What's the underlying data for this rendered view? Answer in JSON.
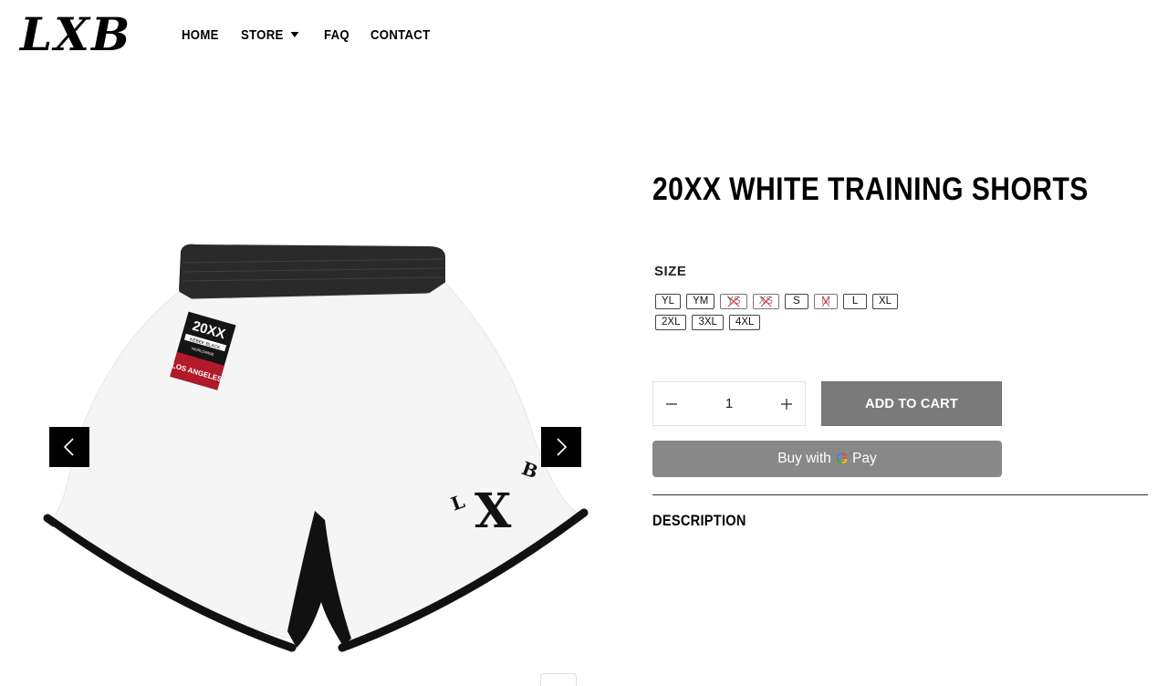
{
  "brand": {
    "logo_text": "LXB"
  },
  "nav": {
    "items": [
      {
        "label": "HOME"
      },
      {
        "label": "STORE",
        "has_dropdown": true
      },
      {
        "label": "FAQ"
      },
      {
        "label": "CONTACT"
      }
    ]
  },
  "gallery": {
    "image_icon": "shorts-product-image",
    "prev_icon": "chevron-left-icon",
    "next_icon": "chevron-right-icon",
    "patch_text_top": "20XX",
    "patch_text_mid": "KEBEK BLACK",
    "patch_text_small": "WORLDWIDE",
    "patch_text_bottom": "LOS ANGELES",
    "print_letters": [
      "L",
      "X",
      "B"
    ]
  },
  "product": {
    "title": "20XX WHITE TRAINING SHORTS",
    "size_label": "SIZE",
    "sizes_row1": [
      {
        "label": "YL",
        "available": true
      },
      {
        "label": "YM",
        "available": true
      },
      {
        "label": "YS",
        "available": false
      },
      {
        "label": "XS",
        "available": false
      },
      {
        "label": "S",
        "available": true
      },
      {
        "label": "M",
        "available": false
      },
      {
        "label": "L",
        "available": true
      },
      {
        "label": "XL",
        "available": true
      }
    ],
    "sizes_row2": [
      {
        "label": "2XL",
        "available": true
      },
      {
        "label": "3XL",
        "available": true
      },
      {
        "label": "4XL",
        "available": true
      }
    ],
    "quantity": "1",
    "add_to_cart_label": "ADD TO CART",
    "gpay_prefix": "Buy with",
    "gpay_g": "G",
    "gpay_suffix": "Pay",
    "description_heading": "DESCRIPTION"
  },
  "colors": {
    "button_gray": "#7a7a7a",
    "gpay_gray": "#888888",
    "black": "#000000",
    "disabled_x": "#dd3333"
  }
}
